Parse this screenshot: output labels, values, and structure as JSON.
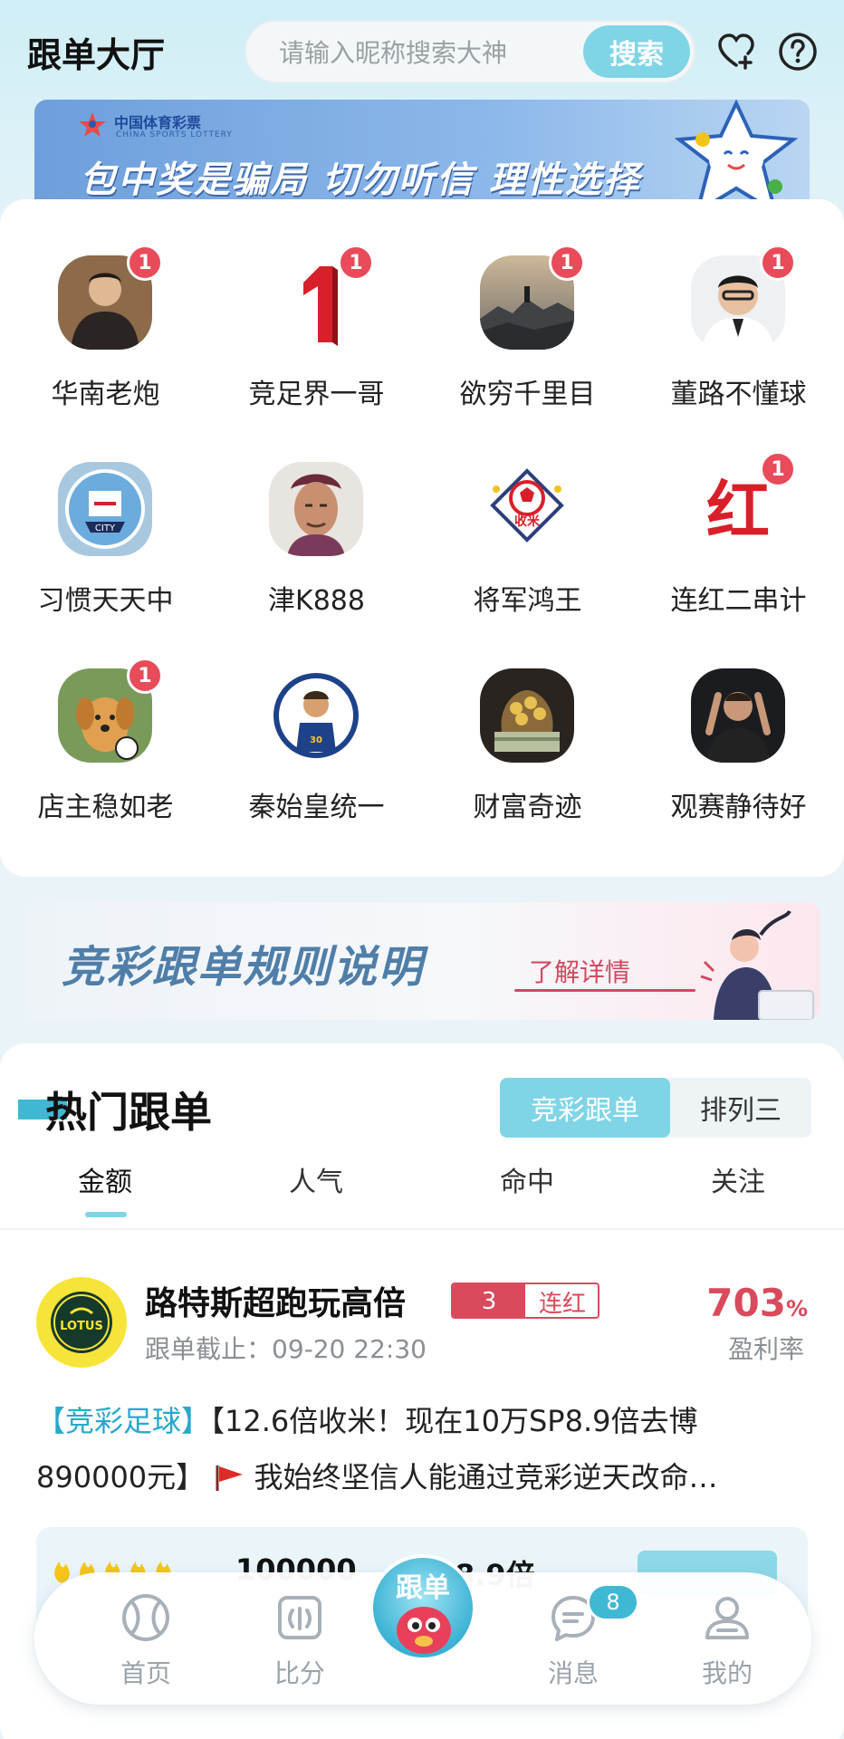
{
  "header": {
    "title": "跟单大厅",
    "search_placeholder": "请输入昵称搜索大神",
    "search_button": "搜索",
    "icons": [
      "heart-plus-icon",
      "help-icon"
    ]
  },
  "banner_top": {
    "logo_cn": "中国体育彩票",
    "logo_en": "CHINA SPORTS LOTTERY",
    "text": "包中奖是骗局 切勿听信 理性选择"
  },
  "experts": [
    {
      "name": "华南老炮",
      "badge": "1"
    },
    {
      "name": "竞足界一哥",
      "badge": "1"
    },
    {
      "name": "欲穷千里目",
      "badge": "1"
    },
    {
      "name": "董路不懂球",
      "badge": "1"
    },
    {
      "name": "习惯天天中",
      "badge": ""
    },
    {
      "name": "津K888",
      "badge": ""
    },
    {
      "name": "将军鸿王",
      "badge": ""
    },
    {
      "name": "连红二串计",
      "badge": "1"
    },
    {
      "name": "店主稳如老",
      "badge": "1"
    },
    {
      "name": "秦始皇统一",
      "badge": ""
    },
    {
      "name": "财富奇迹",
      "badge": ""
    },
    {
      "name": "观赛静待好",
      "badge": ""
    }
  ],
  "banner_rules": {
    "title": "竞彩跟单规则说明",
    "link": "了解详情"
  },
  "hot": {
    "title": "热门跟单",
    "segments": [
      "竞彩跟单",
      "排列三"
    ],
    "tabs": [
      "金额",
      "人气",
      "命中",
      "关注"
    ],
    "post": {
      "logo_text": "LOTUS",
      "title": "路特斯超跑玩高倍",
      "streak_count": "3",
      "streak_label": "连红",
      "deadline": "跟单截止：09-20 22:30",
      "rate_value": "703",
      "rate_unit": "%",
      "rate_label": "盈利率",
      "tag": "【竞彩足球】",
      "body_line1": "【12.6倍收米！现在10万SP8.9倍去博",
      "body_line2": "890000元】",
      "body_line3": "我始终坚信人能通过竞彩逆天改命…",
      "stat_amount": "100000",
      "stat_odds": "8.9倍"
    }
  },
  "nav": {
    "items": [
      {
        "label": "首页",
        "icon": "ball-icon"
      },
      {
        "label": "比分",
        "icon": "score-icon"
      },
      {
        "label": "跟单",
        "icon": "mascot-icon"
      },
      {
        "label": "消息",
        "icon": "message-icon",
        "badge": "8"
      },
      {
        "label": "我的",
        "icon": "profile-icon"
      }
    ]
  }
}
